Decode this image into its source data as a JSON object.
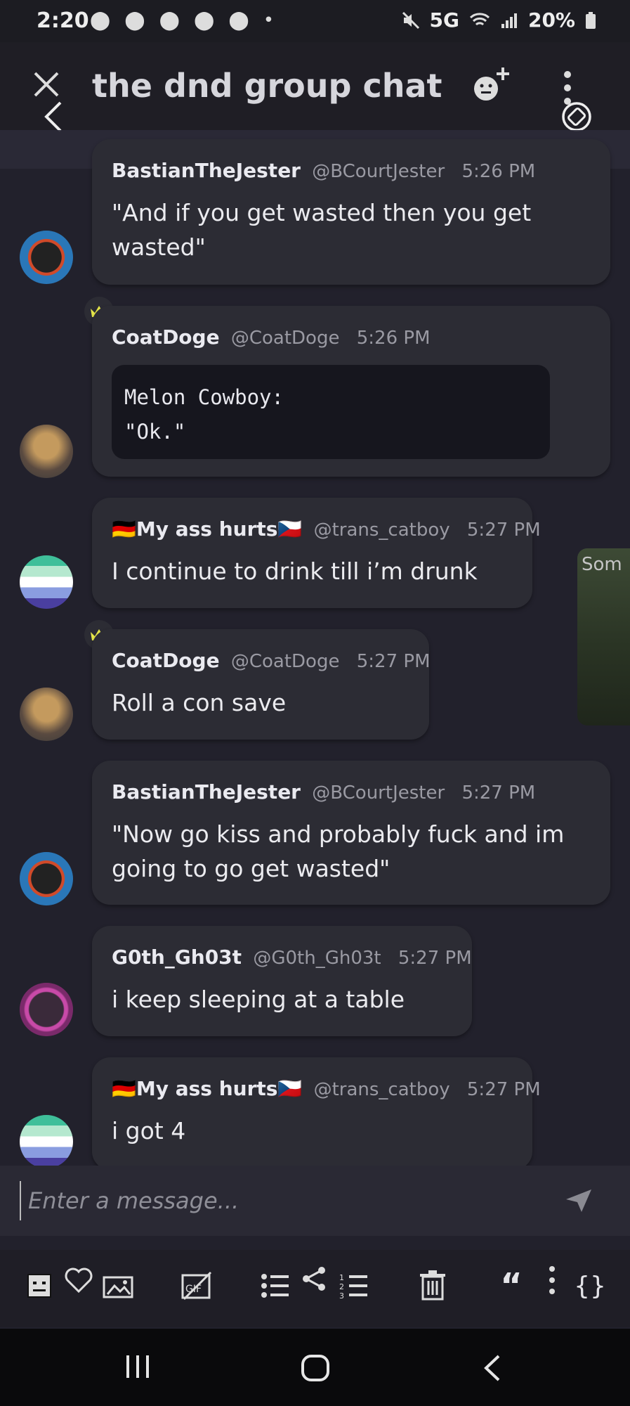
{
  "status_bar": {
    "time": "2:20",
    "notifications": "⬤ ⬤ ⬤ ⬤ ⬤ •",
    "network": "5G",
    "battery": "20%"
  },
  "header": {
    "title": "the dnd group chat"
  },
  "messages": [
    {
      "name": "BastianTheJester",
      "handle": "@BCourtJester",
      "time": "5:26 PM",
      "text_lines": [
        "\"And if you get wasted then you get",
        "wasted\""
      ]
    },
    {
      "name": "CoatDoge",
      "handle": "@CoatDoge",
      "time": "5:26 PM",
      "code_lines": [
        "Melon Cowboy:",
        "\"Ok.\""
      ]
    },
    {
      "name": "🇩🇪My ass hurts🇨🇿",
      "handle": "@trans_catboy",
      "time": "5:27 PM",
      "text_lines": [
        "I continue to drink till i’m drunk"
      ]
    },
    {
      "name": "CoatDoge",
      "handle": "@CoatDoge",
      "time": "5:27 PM",
      "text_lines": [
        "Roll a con save"
      ]
    },
    {
      "name": "BastianTheJester",
      "handle": "@BCourtJester",
      "time": "5:27 PM",
      "text_lines": [
        "\"Now go kiss and probably fuck and im",
        "going to go get wasted\""
      ]
    },
    {
      "name": "G0th_Gh03t",
      "handle": "@G0th_Gh03t",
      "time": "5:27 PM",
      "text_lines": [
        "i keep sleeping at a table"
      ]
    },
    {
      "name": "🇩🇪My ass hurts🇨🇿",
      "handle": "@trans_catboy",
      "time": "5:27 PM",
      "text_lines": [
        "i got 4"
      ]
    }
  ],
  "side_preview": {
    "text": "Som"
  },
  "composer": {
    "placeholder": "Enter a message..."
  },
  "colors": {
    "background": "#22212c",
    "bubble": "#2c2c34",
    "code_block": "#16161e",
    "crown": "#e8e94a"
  }
}
